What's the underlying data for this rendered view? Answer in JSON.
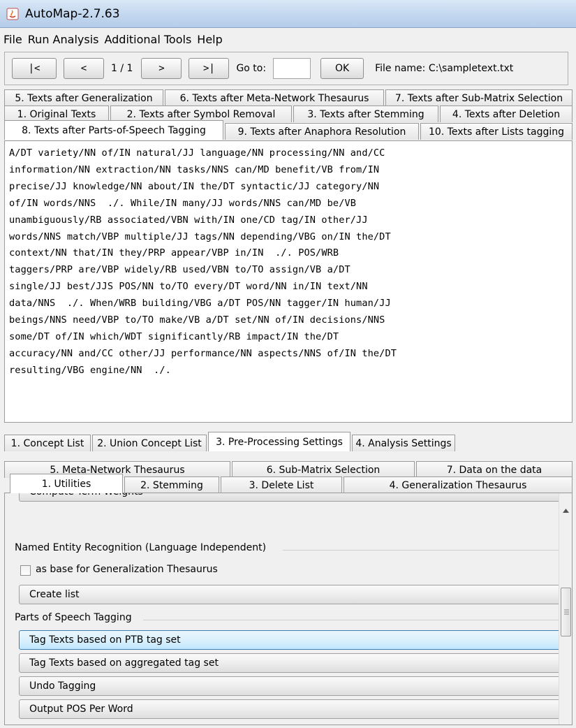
{
  "window": {
    "title": "AutoMap-2.7.63"
  },
  "menu": [
    "File",
    "Run Analysis",
    "Additional Tools",
    "Help"
  ],
  "nav": {
    "first": "|<",
    "prev": "<",
    "page": "1 / 1",
    "next": ">",
    "last": ">|",
    "goto_label": "Go to:",
    "goto_value": "",
    "ok": "OK",
    "filename": "File name: C:\\sampletext.txt"
  },
  "text_tabs": {
    "row1": [
      "5. Texts after Generalization",
      "6. Texts after Meta-Network Thesaurus",
      "7. Texts after Sub-Matrix Selection"
    ],
    "row2": [
      "1. Original Texts",
      "2. Texts after Symbol Removal",
      "3. Texts after Stemming",
      "4. Texts after Deletion"
    ],
    "row3": [
      "8. Texts after Parts-of-Speech Tagging",
      "9. Texts after Anaphora Resolution",
      "10. Texts after Lists tagging"
    ],
    "selected": "8. Texts after Parts-of-Speech Tagging"
  },
  "tagged_text": [
    "A/DT variety/NN of/IN natural/JJ language/NN processing/NN and/CC",
    "information/NN extraction/NN tasks/NNS can/MD benefit/VB from/IN",
    "precise/JJ knowledge/NN about/IN the/DT syntactic/JJ category/NN",
    "of/IN words/NNS  ./. While/IN many/JJ words/NNS can/MD be/VB",
    "unambiguously/RB associated/VBN with/IN one/CD tag/IN other/JJ",
    "words/NNS match/VBP multiple/JJ tags/NN depending/VBG on/IN the/DT",
    "context/NN that/IN they/PRP appear/VBP in/IN  ./. POS/WRB",
    "taggers/PRP are/VBP widely/RB used/VBN to/TO assign/VB a/DT",
    "single/JJ best/JJS POS/NN to/TO every/DT word/NN in/IN text/NN",
    "data/NNS  ./. When/WRB building/VBG a/DT POS/NN tagger/IN human/JJ",
    "beings/NNS need/VBP to/TO make/VB a/DT set/NN of/IN decisions/NNS",
    "some/DT of/IN which/WDT significantly/RB impact/IN the/DT",
    "accuracy/NN and/CC other/JJ performance/NN aspects/NNS of/IN the/DT",
    "resulting/VBG engine/NN  ./."
  ],
  "bottom_tabs": [
    "1. Concept List",
    "2. Union Concept List",
    "3. Pre-Processing Settings",
    "4. Analysis Settings"
  ],
  "bottom_selected": "3. Pre-Processing Settings",
  "pre_tabs": {
    "row1": [
      "5. Meta-Network Thesaurus",
      "6. Sub-Matrix Selection",
      "7. Data on the data"
    ],
    "row2": [
      "1. Utilities",
      "2. Stemming",
      "3. Delete List",
      "4. Generalization Thesaurus"
    ],
    "selected": "1. Utilities"
  },
  "utilities": {
    "partial_button": "Compute Term Weights",
    "ner_label": "Named Entity Recognition (Language Independent)",
    "ner_checkbox": "as base for Generalization Thesaurus",
    "ner_checked": false,
    "create_list": "Create list",
    "pos_label": "Parts of Speech Tagging",
    "pos_buttons": [
      "Tag Texts based on PTB tag set",
      "Tag Texts based on aggregated tag set",
      "Undo Tagging",
      "Output POS Per Word"
    ]
  }
}
